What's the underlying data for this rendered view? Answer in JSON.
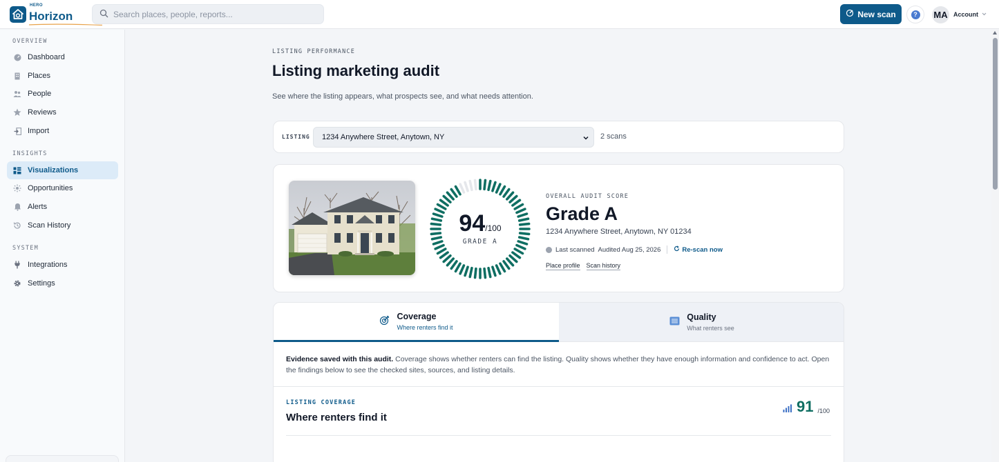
{
  "header": {
    "logo_small": "HERO",
    "logo_main": "Horizon",
    "search_placeholder": "Search places, people, reports...",
    "new_scan_label": "New scan",
    "help_glyph": "?",
    "avatar_initials": "MA",
    "account_label": "Account"
  },
  "sidebar": {
    "sections": [
      {
        "title": "OVERVIEW",
        "items": [
          {
            "label": "Dashboard",
            "icon": "dashboard-icon"
          },
          {
            "label": "Places",
            "icon": "building-icon"
          },
          {
            "label": "People",
            "icon": "people-icon"
          },
          {
            "label": "Reviews",
            "icon": "star-icon"
          },
          {
            "label": "Import",
            "icon": "import-icon"
          }
        ]
      },
      {
        "title": "INSIGHTS",
        "items": [
          {
            "label": "Visualizations",
            "icon": "grid-icon",
            "active": true
          },
          {
            "label": "Opportunities",
            "icon": "sparkle-icon"
          },
          {
            "label": "Alerts",
            "icon": "bell-icon"
          },
          {
            "label": "Scan History",
            "icon": "history-icon"
          }
        ]
      },
      {
        "title": "SYSTEM",
        "items": [
          {
            "label": "Integrations",
            "icon": "plug-icon"
          },
          {
            "label": "Settings",
            "icon": "gear-icon"
          }
        ]
      }
    ]
  },
  "page": {
    "eyebrow": "LISTING PERFORMANCE",
    "title": "Listing marketing audit",
    "description": "See where the listing appears, what prospects see, and what needs attention."
  },
  "listing_selector": {
    "label": "LISTING",
    "selected": "1234 Anywhere Street, Anytown, NY",
    "scan_count": "2 scans"
  },
  "score": {
    "value": 94,
    "value_text": "94",
    "out_of": "/100",
    "gauge_grade": "GRADE A",
    "eyebrow": "OVERALL AUDIT SCORE",
    "grade_title": "Grade A",
    "address": "1234 Anywhere Street, Anytown, NY 01234",
    "last_scanned_label": "Last scanned",
    "audited_text": "Audited Aug 25, 2026",
    "rescan_label": "Re-scan now",
    "links": [
      "Place profile",
      "Scan history"
    ]
  },
  "tabs": [
    {
      "title": "Coverage",
      "subtitle": "Where renters find it",
      "icon": "target-icon",
      "active": true
    },
    {
      "title": "Quality",
      "subtitle": "What renters see",
      "icon": "list-icon",
      "active": false
    }
  ],
  "evidence": {
    "bold": "Evidence saved with this audit.",
    "text": "Coverage shows whether renters can find the listing. Quality shows whether they have enough information and confidence to act. Open the findings below to see the checked sites, sources, and listing details."
  },
  "coverage": {
    "eyebrow": "LISTING COVERAGE",
    "title": "Where renters find it",
    "score": "91",
    "out_of": "/100"
  },
  "colors": {
    "brand": "#0e5a8a",
    "gauge": "#0f6e62",
    "gauge_track": "#e5e7eb"
  }
}
